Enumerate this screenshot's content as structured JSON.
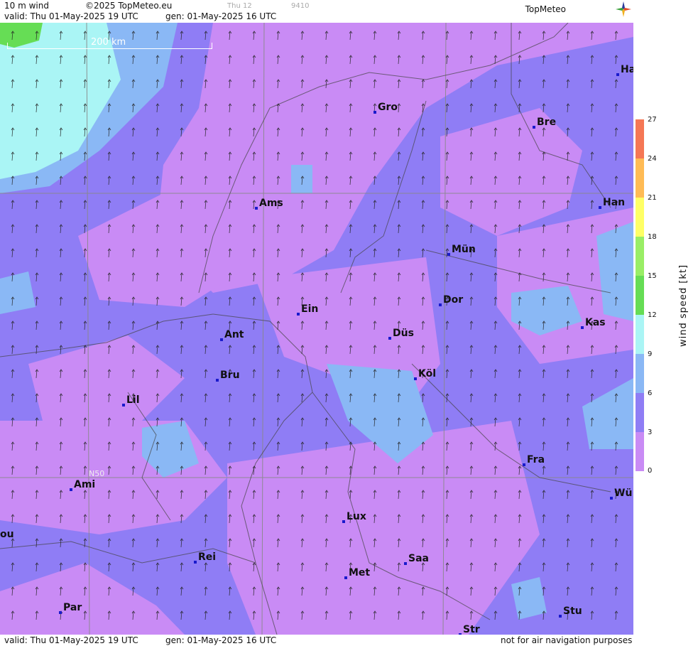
{
  "header": {
    "product": "10 m wind",
    "copyright": "©2025 TopMeteo.eu",
    "step_day": "Thu 12",
    "step_code": "9410",
    "valid": "valid:  Thu  01-May-2025  19 UTC",
    "gen": "gen: 01-May-2025 16 UTC",
    "brand": "TopMeteo"
  },
  "footer": {
    "valid": "valid:  Thu  01-May-2025  19 UTC",
    "gen": "gen: 01-May-2025 16 UTC",
    "disclaimer": "not for air navigation purposes"
  },
  "map": {
    "scale_label": "200 km",
    "lat_label": "N50",
    "cities": [
      "Ha",
      "Gro",
      "Bre",
      "Ams",
      "Han",
      "Mün",
      "Dor",
      "Ein",
      "Kas",
      "Ant",
      "Düs",
      "Bru",
      "Köl",
      "Lil",
      "Fra",
      "Ami",
      "Wü",
      "Lux",
      "ou",
      "Rei",
      "Saa",
      "Met",
      "Par",
      "Stu",
      "Str"
    ]
  },
  "legend": {
    "title": "wind speed [kt]",
    "ticks": [
      "27",
      "24",
      "21",
      "18",
      "15",
      "12",
      "9",
      "6",
      "3",
      "0"
    ],
    "colors": [
      "#c98bf5",
      "#8f7df5",
      "#8ab8f5",
      "#aaf5f5",
      "#66dd55",
      "#ffff66",
      "#ffbb55",
      "#f57755"
    ]
  }
}
